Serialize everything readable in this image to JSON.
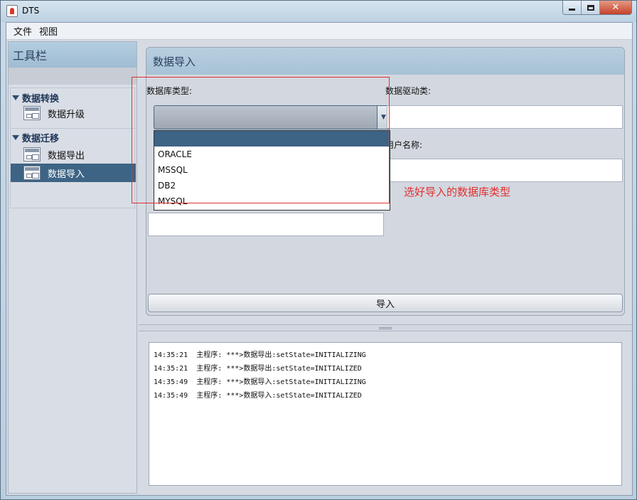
{
  "window": {
    "title": "DTS"
  },
  "menubar": {
    "items": [
      "文件",
      "视图"
    ]
  },
  "toolbar": {
    "title": "工具栏",
    "groups": [
      {
        "label": "数据转换",
        "items": [
          {
            "label": "数据升级"
          }
        ]
      },
      {
        "label": "数据迁移",
        "items": [
          {
            "label": "数据导出"
          },
          {
            "label": "数据导入",
            "selected": true
          }
        ]
      }
    ]
  },
  "main": {
    "title": "数据导入",
    "db_type_label": "数据库类型:",
    "driver_label": "数据驱动类:",
    "username_label": "用户名称:",
    "db_type_selected": "",
    "db_type_options": [
      "",
      "ORACLE",
      "MSSQL",
      "DB2",
      "MYSQL"
    ],
    "import_button": "导入"
  },
  "annotation": {
    "text": "选好导入的数据库类型",
    "color": "#e03030"
  },
  "log": {
    "lines": [
      "14:35:21  主程序: ***>数据导出:setState=INITIALIZING",
      "14:35:21  主程序: ***>数据导出:setState=INITIALIZED",
      "14:35:49  主程序: ***>数据导入:setState=INITIALIZING",
      "14:35:49  主程序: ***>数据导入:setState=INITIALIZED"
    ]
  },
  "colors": {
    "selection": "#3d6485",
    "panel_header": "#a7c2d6",
    "accent_text": "#2a3f5f"
  }
}
